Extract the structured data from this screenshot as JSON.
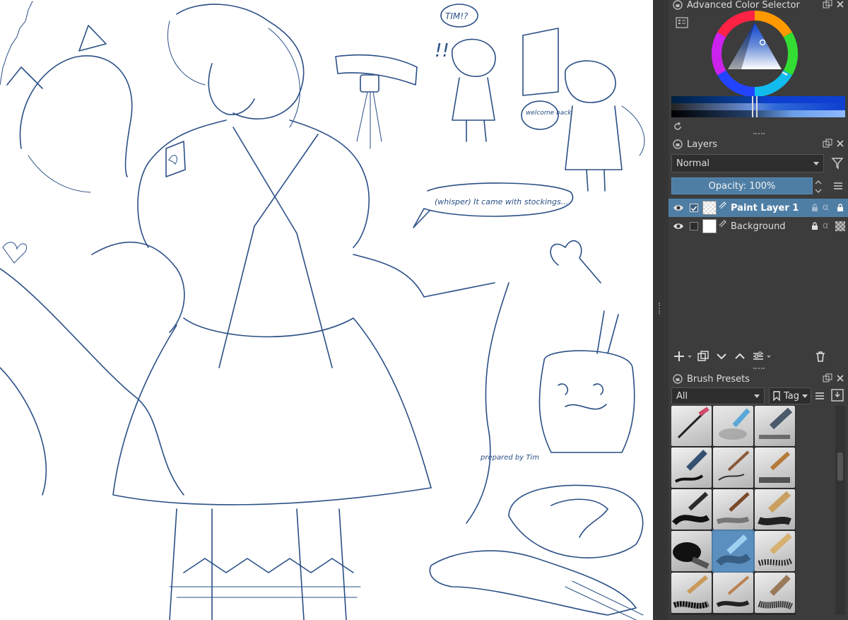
{
  "panels": {
    "color_selector": {
      "title": "Advanced Color Selector"
    },
    "layers": {
      "title": "Layers",
      "blend_mode": "Normal",
      "opacity_label": "Opacity:",
      "opacity_value": "100%",
      "items": [
        {
          "name": "Paint Layer 1",
          "active": true
        },
        {
          "name": "Background",
          "active": false
        }
      ]
    },
    "brush_presets": {
      "title": "Brush Presets",
      "filter": "All",
      "tag_label": "Tag"
    }
  },
  "canvas_text": {
    "tim": "TIM!?",
    "exclaim": "!!",
    "welcome": "welcome back",
    "whisper": "(whisper) It came with stockings...",
    "note": "prepared by Tim"
  },
  "colors": {
    "accent": "#4f7ea5",
    "panel_bg": "#3c3c3c",
    "sketch_ink": "#2a4f86"
  },
  "brush_icons": [
    "pen-brush-icon",
    "airbrush-blending-icon",
    "marker-brush-icon",
    "ink-pen-brush-icon",
    "fine-brush-icon",
    "flat-brush-icon",
    "round-brush-icon",
    "bristle-brush-icon",
    "wide-brush-icon",
    "smudge-brush-icon",
    "paint-roller-brush-icon",
    "texture-brush-icon",
    "dry-brush-icon",
    "detail-brush-icon",
    "fan-brush-icon"
  ]
}
